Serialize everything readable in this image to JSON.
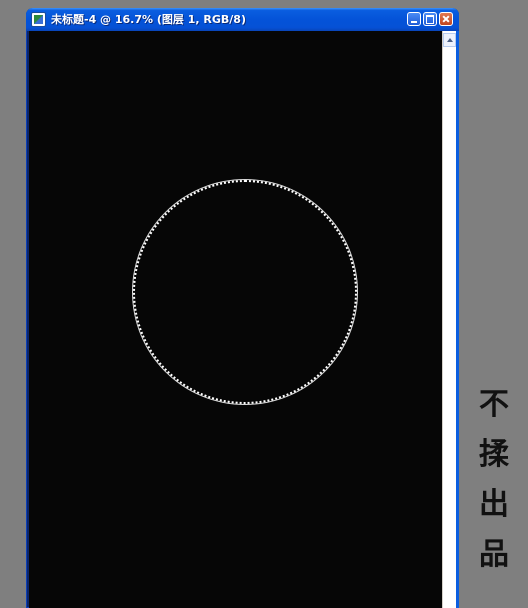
{
  "window": {
    "title": "未标题-4 @ 16.7% (图层 1, RGB/8)",
    "icons": {
      "app": "photoshop-document-icon",
      "minimize": "minimize-icon",
      "maximize": "maximize-icon",
      "close": "close-icon"
    }
  },
  "canvas": {
    "background_color": "#060606",
    "shape": "circle-selection-outline",
    "stroke_color": "#ffffff"
  },
  "scrollbar": {
    "icon": "scroll-up-arrow-icon"
  },
  "watermark": {
    "chars": [
      "不",
      "揉",
      "出",
      "品"
    ]
  }
}
